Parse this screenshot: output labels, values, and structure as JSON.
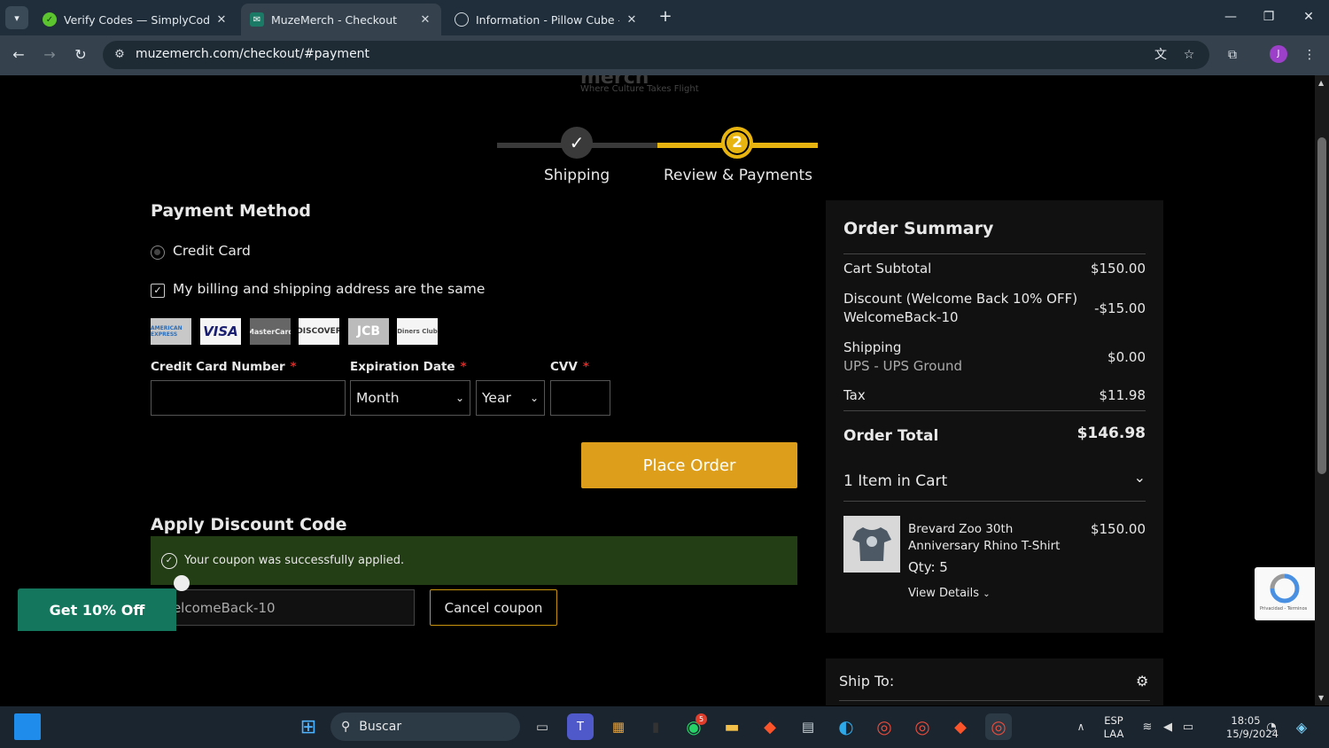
{
  "browser": {
    "tabs": [
      {
        "title": "Verify Codes — SimplyCodes"
      },
      {
        "title": "MuzeMerch - Checkout"
      },
      {
        "title": "Information - Pillow Cube - Che"
      }
    ],
    "url": "muzemerch.com/checkout/#payment",
    "profile_initial": "J"
  },
  "header": {
    "logo": "merch",
    "tagline": "Where Culture Takes Flight"
  },
  "progress": {
    "steps": [
      {
        "label": "Shipping",
        "status": "completed"
      },
      {
        "label": "Review & Payments",
        "number": "2",
        "status": "active"
      }
    ],
    "accent": "#e8b40f"
  },
  "payment": {
    "title": "Payment Method",
    "method_label": "Credit Card",
    "billing_same_label": "My billing and shipping address are the same",
    "cards": [
      "AMERICAN EXPRESS",
      "VISA",
      "MasterCard",
      "DISCOVER",
      "JCB",
      "Diners Club"
    ],
    "card_number_label": "Credit Card Number",
    "expiration_label": "Expiration Date",
    "cvv_label": "CVV",
    "required_mark": "*",
    "month_value": "Month",
    "year_value": "Year",
    "place_order": "Place Order"
  },
  "discount": {
    "title": "Apply Discount Code",
    "success_message": "Your coupon was successfully applied.",
    "code_value": "WelcomeBack-10",
    "cancel_label": "Cancel coupon"
  },
  "summary": {
    "title": "Order Summary",
    "subtotal_label": "Cart Subtotal",
    "subtotal": "$150.00",
    "discount_label": "Discount (Welcome Back 10% OFF)",
    "discount_code": "WelcomeBack-10",
    "discount": "-$15.00",
    "shipping_label": "Shipping",
    "shipping_method": "UPS - UPS Ground",
    "shipping": "$0.00",
    "tax_label": "Tax",
    "tax": "$11.98",
    "total_label": "Order Total",
    "total": "$146.98",
    "items_count_label": "1 Item in Cart",
    "item": {
      "name_line1": "Brevard Zoo 30th",
      "name_line2": "Anniversary Rhino T-Shirt",
      "qty": "Qty: 5",
      "price": "$150.00",
      "view_details": "View Details"
    },
    "ship_to": "Ship To:"
  },
  "promo": {
    "label": "Get 10% Off"
  },
  "recaptcha": {
    "text": "Privacidad - Términos"
  },
  "taskbar": {
    "search_placeholder": "Buscar",
    "lang": "ESP",
    "region": "LAA",
    "time": "18:05",
    "date": "15/9/2024",
    "whatsapp_badge": "5"
  }
}
